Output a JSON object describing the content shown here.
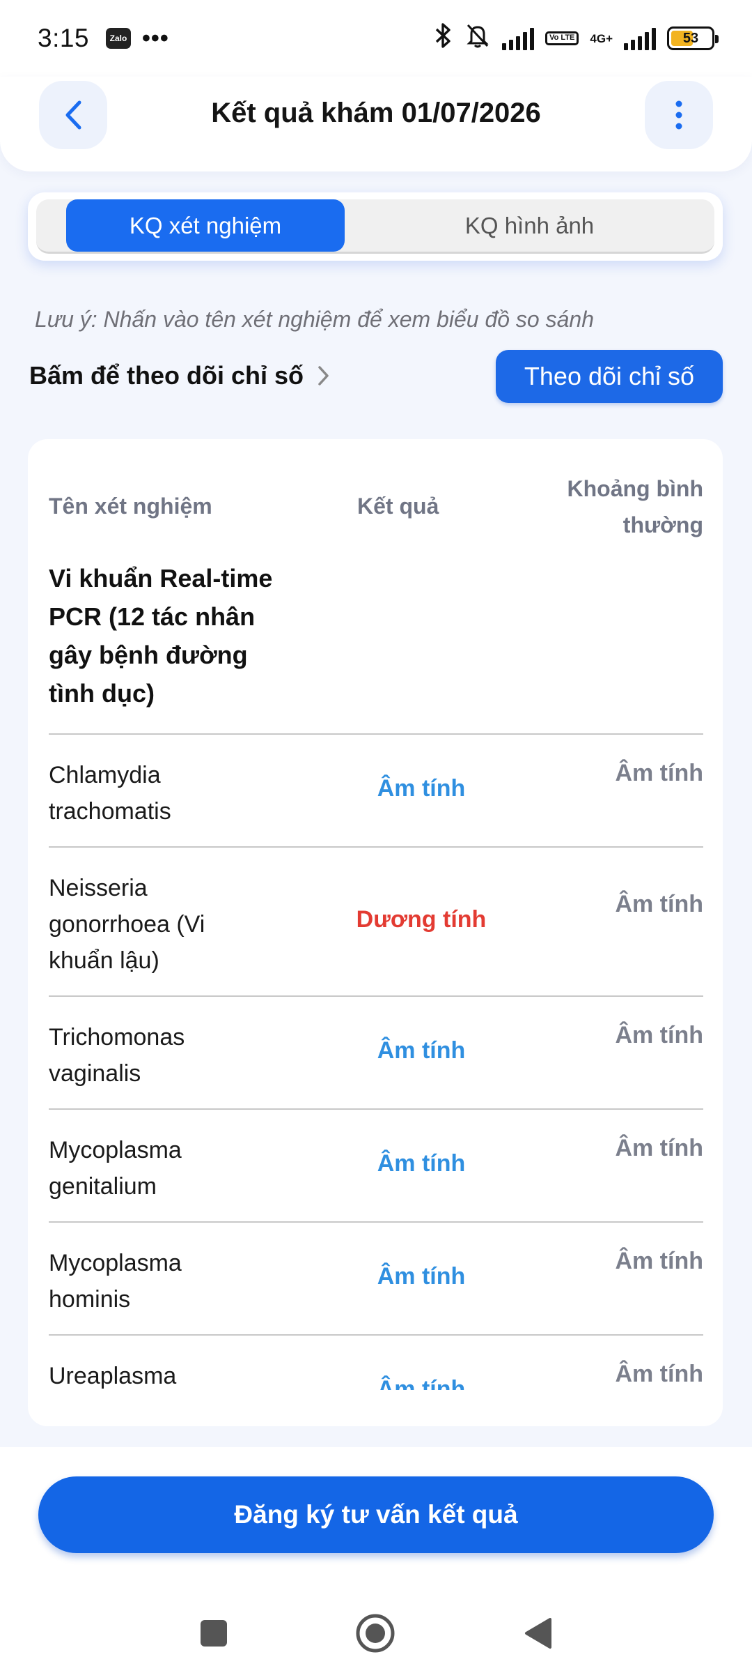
{
  "status_bar": {
    "time": "3:15",
    "app_badge": "Zalo",
    "more_dots": "•••",
    "network": "4G+",
    "volte": "Vo LTE",
    "battery": "53"
  },
  "header": {
    "title": "Kết quả khám 01/07/2026"
  },
  "tabs": [
    {
      "label": "KQ xét nghiệm",
      "active": true
    },
    {
      "label": "KQ hình ảnh",
      "active": false
    }
  ],
  "note": "Lưu ý: Nhấn vào tên xét nghiệm để xem biểu đồ so sánh",
  "tracking": {
    "link_label": "Bấm để theo dõi chỉ số",
    "button_label": "Theo dõi chỉ số"
  },
  "table": {
    "headers": {
      "name": "Tên xét nghiệm",
      "result": "Kết quả",
      "range": "Khoảng bình thường"
    },
    "group_title": "Vi khuẩn Real-time PCR (12 tác nhân gây bệnh đường tình dục)",
    "rows": [
      {
        "name": "Chlamydia trachomatis",
        "result": "Âm tính",
        "range": "Âm tính",
        "status": "negative"
      },
      {
        "name": "Neisseria gonorrhoea (Vi khuẩn lậu)",
        "result": "Dương tính",
        "range": "Âm tính",
        "status": "positive"
      },
      {
        "name": "Trichomonas vaginalis",
        "result": "Âm tính",
        "range": "Âm tính",
        "status": "negative"
      },
      {
        "name": "Mycoplasma genitalium",
        "result": "Âm tính",
        "range": "Âm tính",
        "status": "negative"
      },
      {
        "name": "Mycoplasma hominis",
        "result": "Âm tính",
        "range": "Âm tính",
        "status": "negative"
      },
      {
        "name": "Ureaplasma",
        "result": "Âm tính",
        "range": "Âm tính",
        "status": "negative"
      }
    ]
  },
  "cta": {
    "label": "Đăng ký tư vấn kết quả"
  },
  "colors": {
    "primary": "#1a6cf0",
    "negative_result": "#2f8fe0",
    "positive_result": "#e33b32",
    "muted_text": "#7b7f8c",
    "page_background": "#f3f6fd"
  },
  "nav_bar": {
    "icons": [
      "recent-apps-icon",
      "home-icon",
      "back-icon"
    ]
  }
}
